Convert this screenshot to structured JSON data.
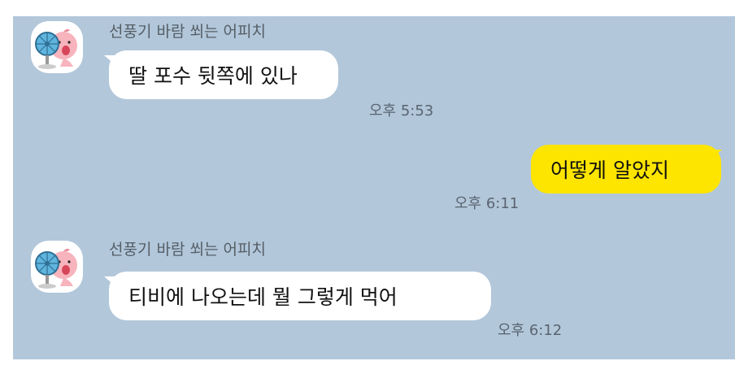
{
  "chat": {
    "messages": [
      {
        "direction": "incoming",
        "sender": "선풍기 바람 쐬는 어피치",
        "avatar_icon": "apeach-fan-avatar-icon",
        "text": "딸 포수 뒷쪽에 있나",
        "time": "오후 5:53"
      },
      {
        "direction": "outgoing",
        "text": "어떻게 알았지",
        "time": "오후 6:11"
      },
      {
        "direction": "incoming",
        "sender": "선풍기 바람 쐬는 어피치",
        "avatar_icon": "apeach-fan-avatar-icon",
        "text": "티비에 나오는데 뭘 그렇게 먹어",
        "time": "오후 6:12"
      }
    ]
  },
  "colors": {
    "background": "#b2c7da",
    "incoming_bubble": "#ffffff",
    "outgoing_bubble": "#fee500",
    "timestamp": "#5a6470"
  }
}
